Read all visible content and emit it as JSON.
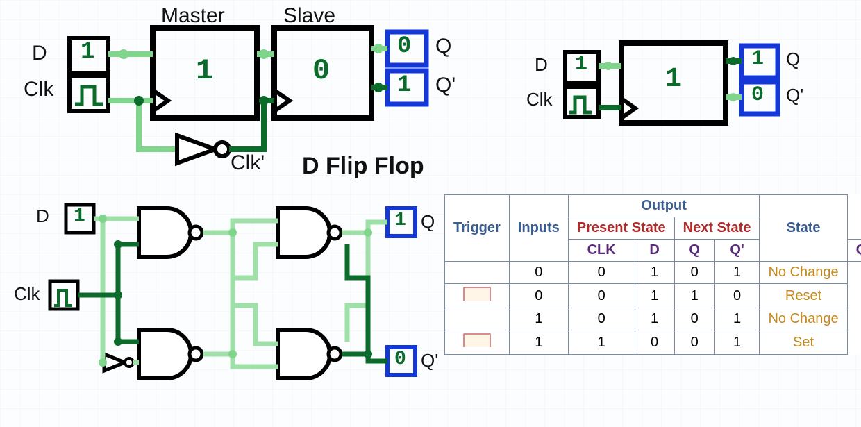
{
  "title": "D Flip Flop",
  "top_left": {
    "master_label": "Master",
    "slave_label": "Slave",
    "d_label": "D",
    "clk_label": "Clk",
    "q_label": "Q",
    "qbar_label": "Q'",
    "clkbar_label": "Clk'",
    "d_val": "1",
    "master_val": "1",
    "slave_val": "0",
    "q_val": "0",
    "qbar_val": "1"
  },
  "top_right": {
    "d_label": "D",
    "clk_label": "Clk",
    "q_label": "Q",
    "qbar_label": "Q'",
    "d_val": "1",
    "latch_val": "1",
    "q_val": "1",
    "qbar_val": "0"
  },
  "bottom_left": {
    "d_label": "D",
    "clk_label": "Clk",
    "q_label": "Q",
    "qbar_label": "Q'",
    "d_val": "1",
    "q_val": "1",
    "qbar_val": "0"
  },
  "truth": {
    "headers": {
      "trigger": "Trigger",
      "inputs": "Inputs",
      "output": "Output",
      "present": "Present State",
      "next": "Next State",
      "state": "State",
      "clk": "CLK",
      "d": "D",
      "q": "Q",
      "qbar": "Q'"
    },
    "rows": [
      {
        "trigger": "",
        "d": "0",
        "pq": "0",
        "pqb": "1",
        "nq": "0",
        "nqb": "1",
        "state": "No Change"
      },
      {
        "trigger": "pulse",
        "d": "0",
        "pq": "0",
        "pqb": "1",
        "nq": "1",
        "nqb": "0",
        "state": "Reset"
      },
      {
        "trigger": "",
        "d": "1",
        "pq": "0",
        "pqb": "1",
        "nq": "0",
        "nqb": "1",
        "state": "No Change"
      },
      {
        "trigger": "pulse",
        "d": "1",
        "pq": "1",
        "pqb": "0",
        "nq": "0",
        "nqb": "1",
        "state": "Set"
      }
    ]
  }
}
